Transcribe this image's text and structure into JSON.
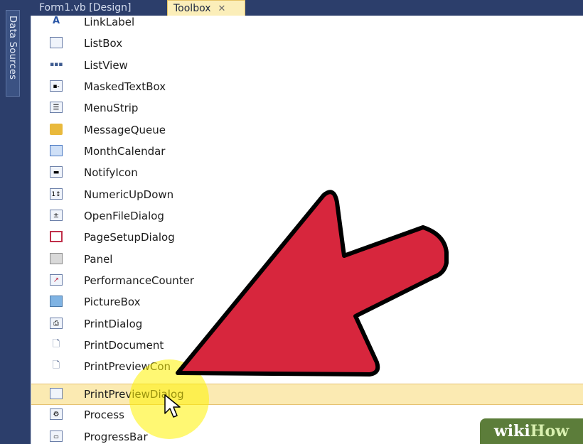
{
  "side_panel": {
    "label": "Data Sources"
  },
  "tabs": [
    {
      "label": "Form1.vb [Design]",
      "active": false
    },
    {
      "label": "Toolbox",
      "active": true,
      "close": "✕"
    }
  ],
  "toolbox": {
    "items": [
      {
        "label": "LinkLabel",
        "icon": "link-label-icon"
      },
      {
        "label": "ListBox",
        "icon": "listbox-icon"
      },
      {
        "label": "ListView",
        "icon": "listview-icon"
      },
      {
        "label": "MaskedTextBox",
        "icon": "masked-textbox-icon"
      },
      {
        "label": "MenuStrip",
        "icon": "menustrip-icon"
      },
      {
        "label": "MessageQueue",
        "icon": "message-queue-icon"
      },
      {
        "label": "MonthCalendar",
        "icon": "calendar-icon"
      },
      {
        "label": "NotifyIcon",
        "icon": "notify-icon"
      },
      {
        "label": "NumericUpDown",
        "icon": "numeric-updown-icon"
      },
      {
        "label": "OpenFileDialog",
        "icon": "open-file-dialog-icon"
      },
      {
        "label": "PageSetupDialog",
        "icon": "page-setup-icon"
      },
      {
        "label": "Panel",
        "icon": "panel-icon"
      },
      {
        "label": "PerformanceCounter",
        "icon": "performance-counter-icon"
      },
      {
        "label": "PictureBox",
        "icon": "picturebox-icon"
      },
      {
        "label": "PrintDialog",
        "icon": "print-dialog-icon"
      },
      {
        "label": "PrintDocument",
        "icon": "print-document-icon"
      },
      {
        "label": "PrintPreviewCon",
        "icon": "print-preview-control-icon"
      },
      {
        "label": "PrintPreviewDialog",
        "icon": "print-preview-dialog-icon",
        "selected": true
      },
      {
        "label": "Process",
        "icon": "process-icon"
      },
      {
        "label": "ProgressBar",
        "icon": "progressbar-icon"
      }
    ]
  },
  "watermark": {
    "part1": "wiki",
    "part2": "How"
  },
  "colors": {
    "arrow": "#d7263d",
    "highlight": "#fff200",
    "selection": "#fbeab2"
  }
}
